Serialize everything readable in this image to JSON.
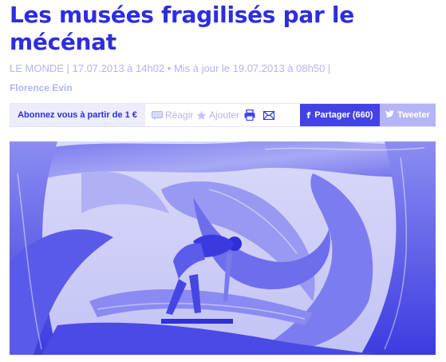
{
  "article": {
    "title": "Les musées fragilisés par le mécénat",
    "meta": "LE MONDE | 17.07.2013 à 14h02 • Mis à jour le 19.07.2013 à 08h50 |",
    "author": "Florence Evin"
  },
  "toolbar": {
    "subscribe_label": "Abonnez vous à partir de 1 €",
    "react_label": "Réagir",
    "add_label": "Ajouter",
    "share_facebook_label": "Partager (660)",
    "facebook_glyph": "f",
    "tweet_label": "Tweeter"
  },
  "colors": {
    "accent": "#2d2de0",
    "muted": "#b3b3f0",
    "facebook": "#4343e5",
    "twitter": "#b5b5f5"
  }
}
